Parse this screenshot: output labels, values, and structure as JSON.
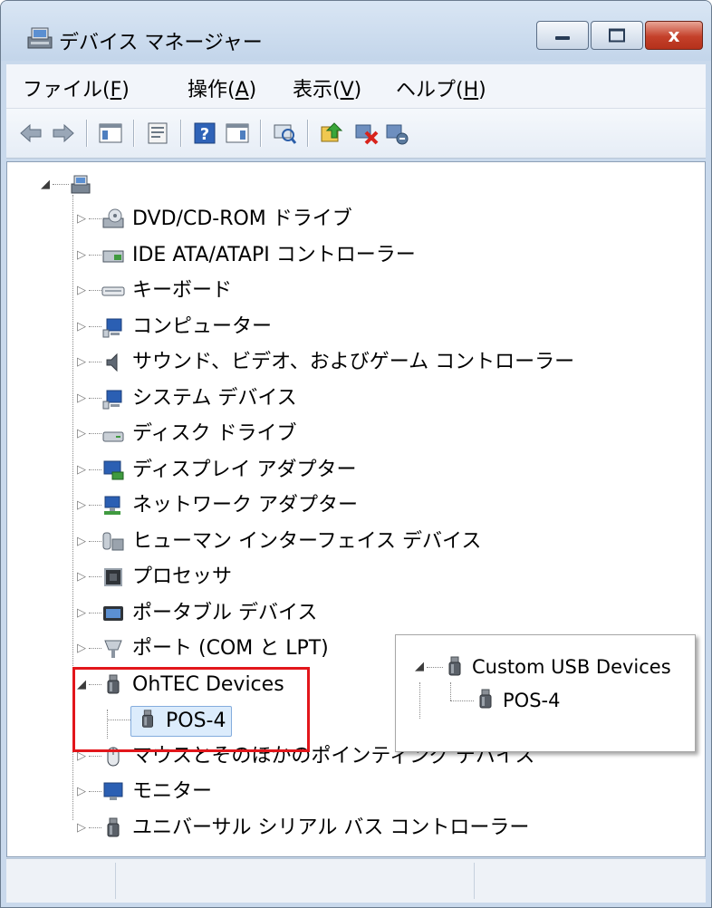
{
  "window": {
    "title": "デバイス マネージャー",
    "close_glyph": "x"
  },
  "menu": [
    {
      "label": "ファイル(",
      "key": "F",
      "end": ")"
    },
    {
      "label": "操作(",
      "key": "A",
      "end": ")"
    },
    {
      "label": "表示(",
      "key": "V",
      "end": ")"
    },
    {
      "label": "ヘルプ(",
      "key": "H",
      "end": ")"
    }
  ],
  "toolbar": {
    "buttons": [
      "back-icon",
      "forward-icon",
      "console-tree-icon",
      "properties-icon",
      "help-icon",
      "action-pane-icon",
      "scan-hardware-icon",
      "update-driver-icon",
      "uninstall-icon",
      "disable-icon"
    ]
  },
  "tree": {
    "root_label": "",
    "categories": [
      {
        "label": "DVD/CD-ROM ドライブ",
        "icon": "dvd-drive-icon"
      },
      {
        "label": "IDE ATA/ATAPI コントローラー",
        "icon": "ide-controller-icon"
      },
      {
        "label": "キーボード",
        "icon": "keyboard-icon"
      },
      {
        "label": "コンピューター",
        "icon": "computer-icon"
      },
      {
        "label": "サウンド、ビデオ、およびゲーム コントローラー",
        "icon": "speaker-icon"
      },
      {
        "label": "システム デバイス",
        "icon": "system-device-icon"
      },
      {
        "label": "ディスク ドライブ",
        "icon": "disk-drive-icon"
      },
      {
        "label": "ディスプレイ アダプター",
        "icon": "display-adapter-icon"
      },
      {
        "label": "ネットワーク アダプター",
        "icon": "network-adapter-icon"
      },
      {
        "label": "ヒューマン インターフェイス デバイス",
        "icon": "hid-icon"
      },
      {
        "label": "プロセッサ",
        "icon": "processor-icon"
      },
      {
        "label": "ポータブル デバイス",
        "icon": "portable-device-icon"
      },
      {
        "label": "ポート (COM と LPT)",
        "icon": "port-icon"
      },
      {
        "label": "OhTEC Devices",
        "icon": "usb-plug-icon",
        "expanded": true,
        "children": [
          {
            "label": "POS-4",
            "selected": true
          }
        ]
      },
      {
        "label": "マウスとそのほかのポインティング デバイス",
        "icon": "mouse-icon"
      },
      {
        "label": "モニター",
        "icon": "monitor-icon"
      },
      {
        "label": "ユニバーサル シリアル バス コントローラー",
        "icon": "usb-plug-icon"
      }
    ]
  },
  "callout": {
    "parent_label": "Custom USB Devices",
    "child_label": "POS-4"
  },
  "colors": {
    "highlight_box": "#e2161b",
    "selection": "#dcecfc",
    "close_button": "#c4402a"
  }
}
